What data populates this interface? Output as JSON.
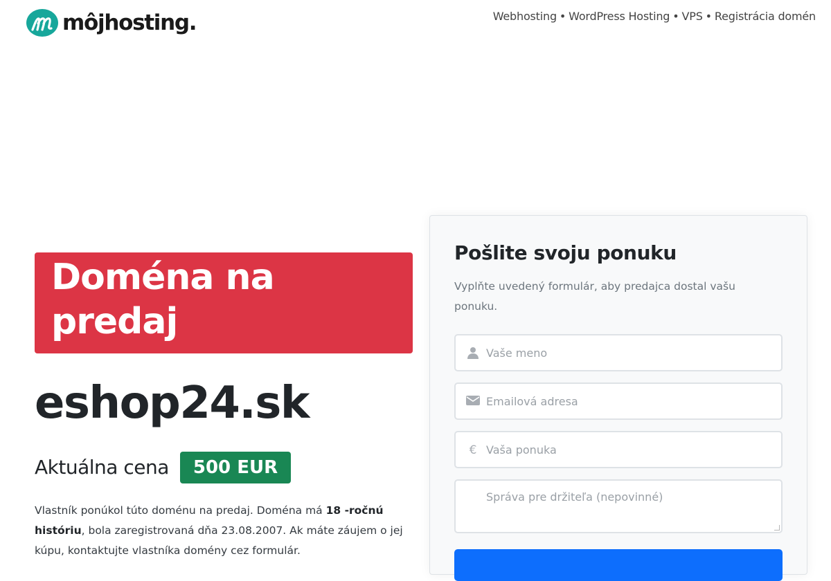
{
  "header": {
    "logo_text": "môjhosting.",
    "nav": [
      {
        "label": "Webhosting"
      },
      {
        "label": "WordPress Hosting"
      },
      {
        "label": "VPS"
      },
      {
        "label": "Registrácia domén"
      }
    ],
    "nav_separator": "•"
  },
  "main": {
    "banner_title": "Doména na predaj",
    "domain": "eshop24.sk",
    "price_label": "Aktuálna cena",
    "price_value": "500 EUR",
    "description": {
      "part1": "Vlastník ponúkol túto doménu na predaj. Doména má ",
      "bold": "18 -ročnú históriu",
      "part2": ", bola zaregistrovaná dňa 23.08.2007. Ak máte záujem o jej kúpu, kontaktujte vlastníka domény cez formulár."
    }
  },
  "form": {
    "title": "Pošlite svoju ponuku",
    "subtitle": "Vyplňte uvedený formulár, aby predajca dostal vašu ponuku.",
    "name_placeholder": "Vaše meno",
    "email_placeholder": "Emailová adresa",
    "offer_placeholder": "Vaša ponuka",
    "message_placeholder": "Správa pre držiteľa (nepovinné)",
    "icons": {
      "name": "user-icon",
      "email": "envelope-icon",
      "offer": "euro-icon"
    }
  },
  "colors": {
    "brand_teal": "#17a79b",
    "banner_red": "#dc3545",
    "price_green": "#198754",
    "button_blue": "#0d6efd"
  }
}
